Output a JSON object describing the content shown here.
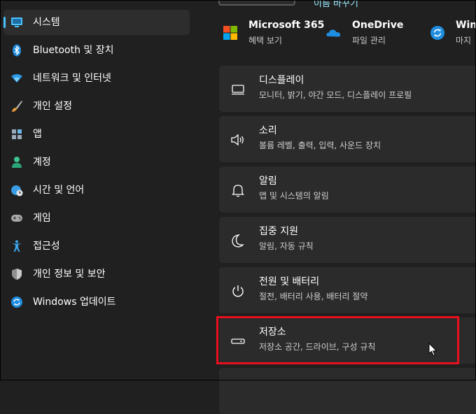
{
  "sidebar": {
    "items": [
      {
        "label": "시스템",
        "icon": "monitor-icon",
        "selected": true
      },
      {
        "label": "Bluetooth 및 장치",
        "icon": "bluetooth-icon"
      },
      {
        "label": "네트워크 및 인터넷",
        "icon": "wifi-icon"
      },
      {
        "label": "개인 설정",
        "icon": "brush-icon"
      },
      {
        "label": "앱",
        "icon": "apps-icon"
      },
      {
        "label": "계정",
        "icon": "person-icon"
      },
      {
        "label": "시간 및 언어",
        "icon": "globe-clock-icon"
      },
      {
        "label": "게임",
        "icon": "gamepad-icon"
      },
      {
        "label": "접근성",
        "icon": "accessibility-icon"
      },
      {
        "label": "개인 정보 및 보안",
        "icon": "shield-icon"
      },
      {
        "label": "Windows 업데이트",
        "icon": "update-icon"
      }
    ]
  },
  "top": {
    "link": "이름 바꾸기"
  },
  "apps": [
    {
      "name": "Microsoft 365",
      "sub": "혜택 보기",
      "icon": "microsoft-logo-icon"
    },
    {
      "name": "OneDrive",
      "sub": "파일 관리",
      "icon": "onedrive-icon"
    },
    {
      "name": "Wind",
      "sub": "마지",
      "icon": "windows-update-icon"
    }
  ],
  "cards": [
    {
      "title": "디스플레이",
      "desc": "모니터, 밝기, 야간 모드, 디스플레이 프로필",
      "icon": "display-icon"
    },
    {
      "title": "소리",
      "desc": "볼륨 레벨, 출력, 입력, 사운드 장치",
      "icon": "speaker-icon"
    },
    {
      "title": "알림",
      "desc": "앱 및 시스템의 알림",
      "icon": "bell-icon"
    },
    {
      "title": "집중 지원",
      "desc": "알림, 자동 규칙",
      "icon": "moon-icon"
    },
    {
      "title": "전원 및 배터리",
      "desc": "절전, 배터리 사용, 배터리 절약",
      "icon": "power-icon"
    },
    {
      "title": "저장소",
      "desc": "저장소 공간, 드라이브, 구성 규칙",
      "icon": "storage-icon"
    }
  ],
  "colors": {
    "accent": "#4cc2ff",
    "highlight": "#e8101f",
    "background": "#202020",
    "card": "#2b2b2b"
  }
}
